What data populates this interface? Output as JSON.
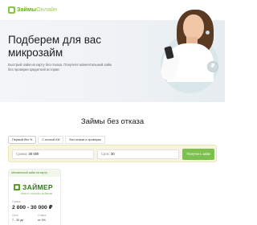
{
  "header": {
    "logo_main": "Займы",
    "logo_accent": "Онлайн",
    "logo_icon": "logo-square-icon"
  },
  "hero": {
    "title": "Подберем для вас микрозайм",
    "subtitle": "Быстрый займ на карту без отказа. Получите моментальный займ без проверки кредитной истории",
    "coin_symbol": "₽"
  },
  "section": {
    "title": "Займы без отказа"
  },
  "tabs": [
    {
      "label": "Первый без %"
    },
    {
      "label": "С плохой КИ"
    },
    {
      "label": "Без отказа и проверки"
    }
  ],
  "filter": {
    "sum_label": "Сумма:",
    "sum_value": "30 000",
    "term_label": "Срок:",
    "term_value": "30",
    "button_label": "Получить займ"
  },
  "offer": {
    "badge": "Мгновенный займ на карту",
    "brand": "ЗАЙМЕР",
    "brand_tagline": "РОБОТ ОНЛАЙН-ЗАЙМОВ",
    "sum_label": "Сумма",
    "sum_value": "2 000 - 30 000 ₽",
    "term_label": "Срок",
    "rate_label": "Ставка",
    "term_value": "7 - 30 дн",
    "rate_value": "от 0%"
  },
  "colors": {
    "accent_green": "#7cc04e",
    "brand_green": "#2f7a1a",
    "filter_bg": "#f7f5df"
  }
}
